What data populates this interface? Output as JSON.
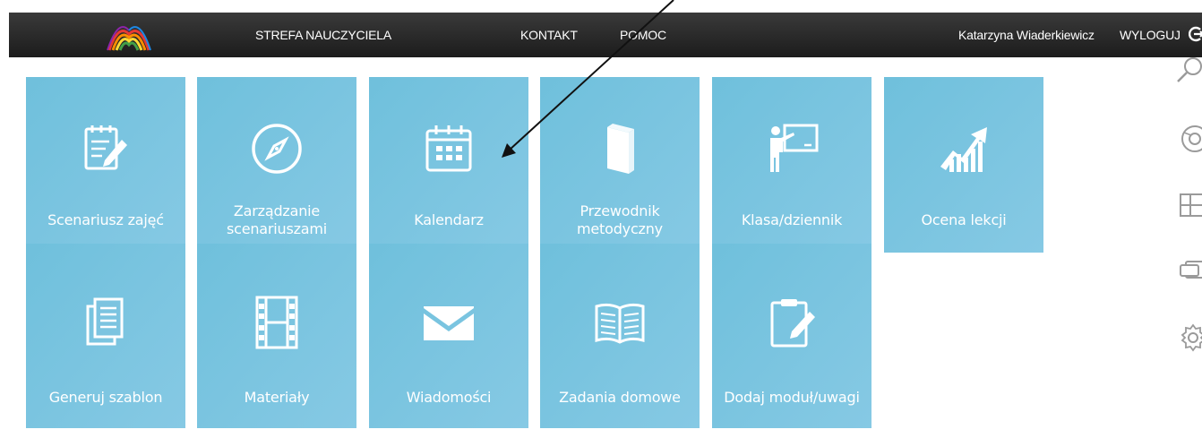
{
  "header": {
    "logo": "rainbow-arches-logo",
    "title": "STREFA NAUCZYCIELA",
    "nav": [
      "KONTAKT",
      "POMOC"
    ],
    "user_name": "Katarzyna Wiaderkiewicz",
    "logout_label": "WYLOGUJ",
    "logout_icon": "logout-icon"
  },
  "tiles": [
    {
      "label": "Scenariusz zajęć",
      "icon": "edit-document-icon"
    },
    {
      "label": "Zarządzanie\nscenariuszami",
      "icon": "compass-icon"
    },
    {
      "label": "Kalendarz",
      "icon": "calendar-icon"
    },
    {
      "label": "Przewodnik\nmetodyczny",
      "icon": "book-icon"
    },
    {
      "label": "Klasa/dziennik",
      "icon": "teacher-board-icon"
    },
    {
      "label": "Ocena lekcji",
      "icon": "growth-chart-icon"
    },
    {
      "label": "Generuj szablon",
      "icon": "documents-icon"
    },
    {
      "label": "Materiały",
      "icon": "film-icon"
    },
    {
      "label": "Wiadomości",
      "icon": "envelope-icon"
    },
    {
      "label": "Zadania domowe",
      "icon": "open-book-icon"
    },
    {
      "label": "Dodaj moduł/uwagi",
      "icon": "clipboard-edit-icon"
    }
  ],
  "side_icons": [
    "search-icon",
    "chrome-icon",
    "windows-icon",
    "task-view-icon",
    "settings-icon"
  ],
  "colors": {
    "tile": "#7cc4e0",
    "topbar": "#262626",
    "text_light": "#ffffff",
    "side_icon": "#9a9a9a"
  }
}
